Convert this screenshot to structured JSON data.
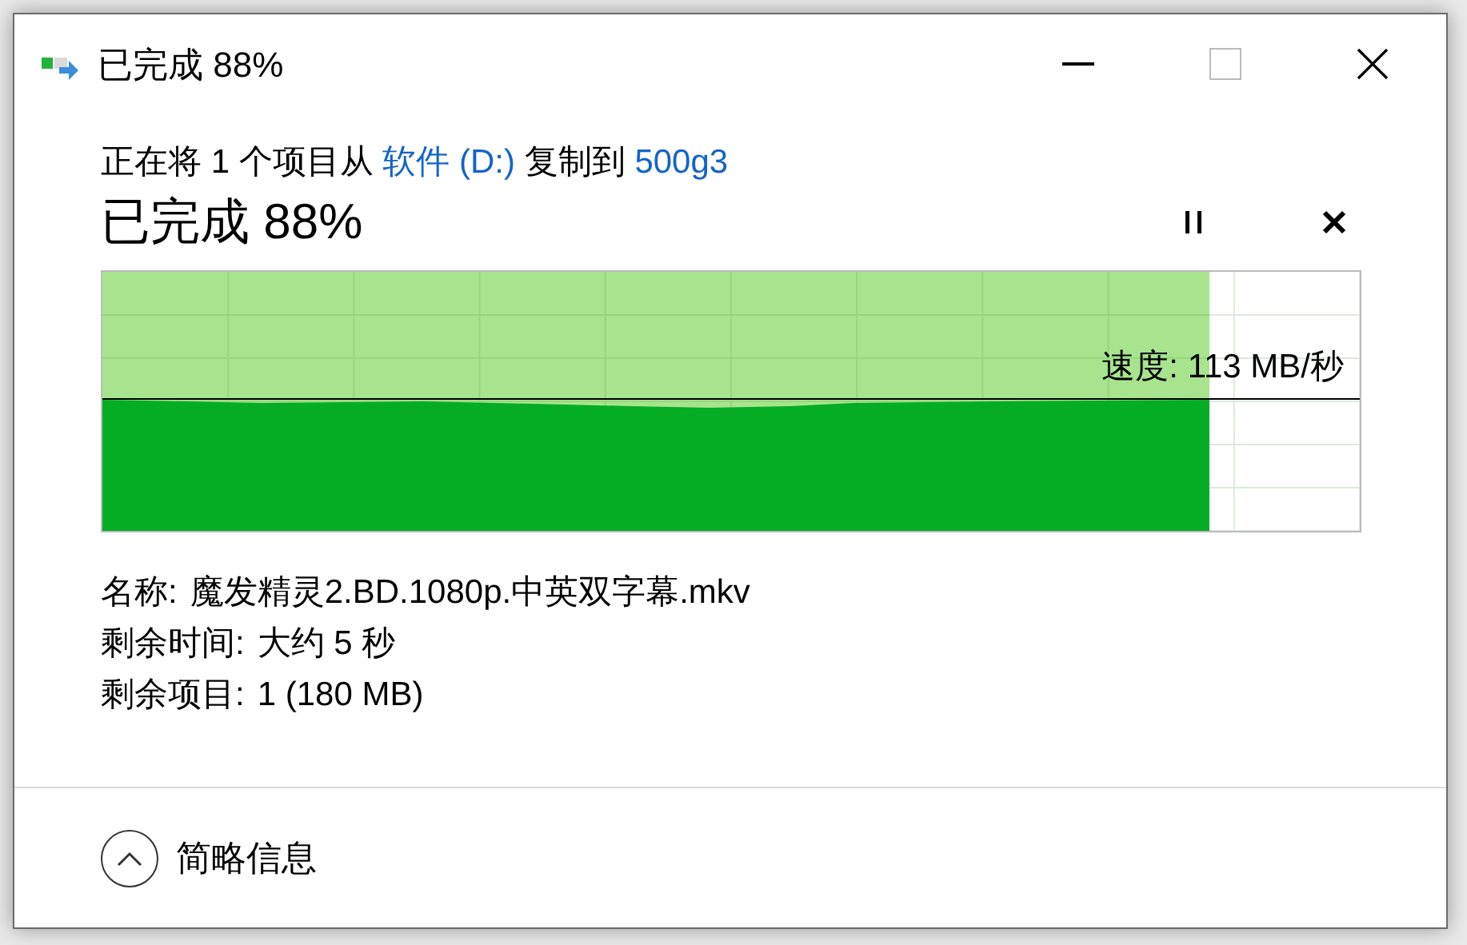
{
  "window": {
    "title": "已完成 88%"
  },
  "description": [
    {
      "kind": "plain",
      "text": "正在将 1 个项目从 "
    },
    {
      "kind": "link",
      "text": "软件 (D:)"
    },
    {
      "kind": "plain",
      "text": " 复制到 "
    },
    {
      "kind": "link",
      "text": "500g3"
    }
  ],
  "status": "已完成 88%",
  "progress": {
    "level": 0.88,
    "speed": "速度: 113 MB/秒"
  },
  "details": [
    {
      "label": "名称:",
      "value": "魔发精灵2.BD.1080p.中英双字幕.mkv"
    },
    {
      "label": "剩余时间:",
      "value": "大约 5 秒"
    },
    {
      "label": "剩余项目:",
      "value": "1 (180 MB)"
    }
  ],
  "footer": {
    "label": "简略信息",
    "expanded": true
  }
}
